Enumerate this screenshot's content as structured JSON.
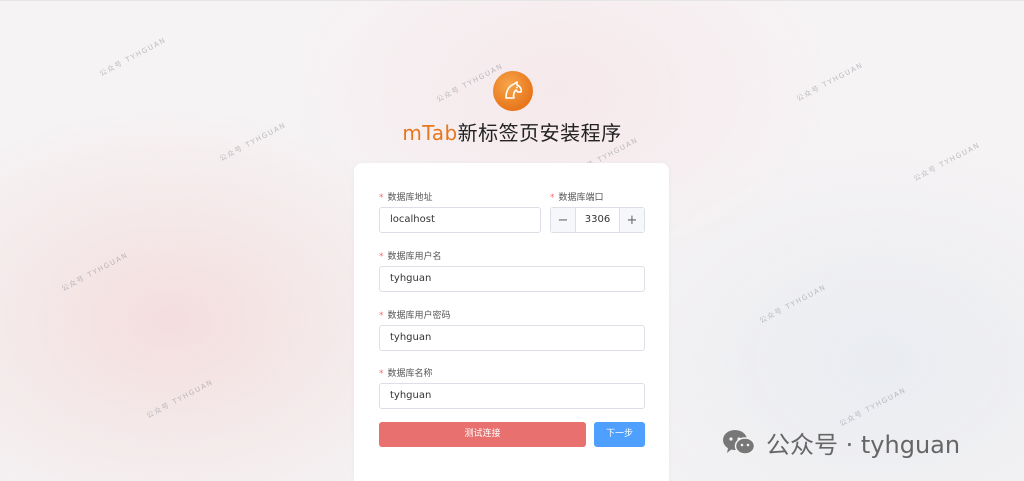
{
  "app": {
    "brand": "mTab",
    "title_rest": "新标签页安装程序"
  },
  "form": {
    "db_address": {
      "label": "数据库地址",
      "value": "localhost"
    },
    "db_port": {
      "label": "数据库端口",
      "value": "3306",
      "minus": "−",
      "plus": "+"
    },
    "db_user": {
      "label": "数据库用户名",
      "value": "tyhguan"
    },
    "db_password": {
      "label": "数据库用户密码",
      "value": "tyhguan"
    },
    "db_name": {
      "label": "数据库名称",
      "value": "tyhguan"
    },
    "required_mark": "*"
  },
  "buttons": {
    "test_connection": "测试连接",
    "next_step": "下一步"
  },
  "watermark": {
    "text": "公众号 · tyhguan",
    "small_text": "公众号 TYHGUAN"
  },
  "colors": {
    "brand_orange": "#e8761c",
    "test_button": "#e8716f",
    "next_button": "#4f9ffe",
    "required": "#f56c6c"
  }
}
